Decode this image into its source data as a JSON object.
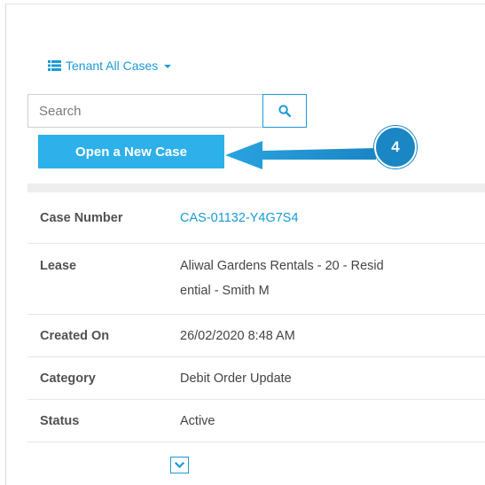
{
  "view": {
    "label": "Tenant All Cases",
    "icon": "list-icon"
  },
  "search": {
    "placeholder": "Search",
    "button_icon": "search-icon"
  },
  "actions": {
    "new_case_label": "Open a New Case"
  },
  "callout": {
    "step_number": "4",
    "arrow_icon": "arrow-left-icon"
  },
  "case_details": {
    "rows": [
      {
        "label": "Case Number",
        "value": "CAS-01132-Y4G7S4"
      },
      {
        "label": "Lease",
        "value_line1": "Aliwal Gardens Rentals - 20 - Resid",
        "value_line2": "ential - Smith M"
      },
      {
        "label": "Created On",
        "value": "26/02/2020 8:48 AM"
      },
      {
        "label": "Category",
        "value": "Debit Order Update"
      },
      {
        "label": "Status",
        "value": "Active"
      }
    ],
    "expand_icon": "chevron-down-icon"
  },
  "colors": {
    "accent": "#1a9ad6",
    "button_bg": "#2eb0ea",
    "callout_badge": "#1a86c4",
    "separator": "#eeeeee"
  }
}
